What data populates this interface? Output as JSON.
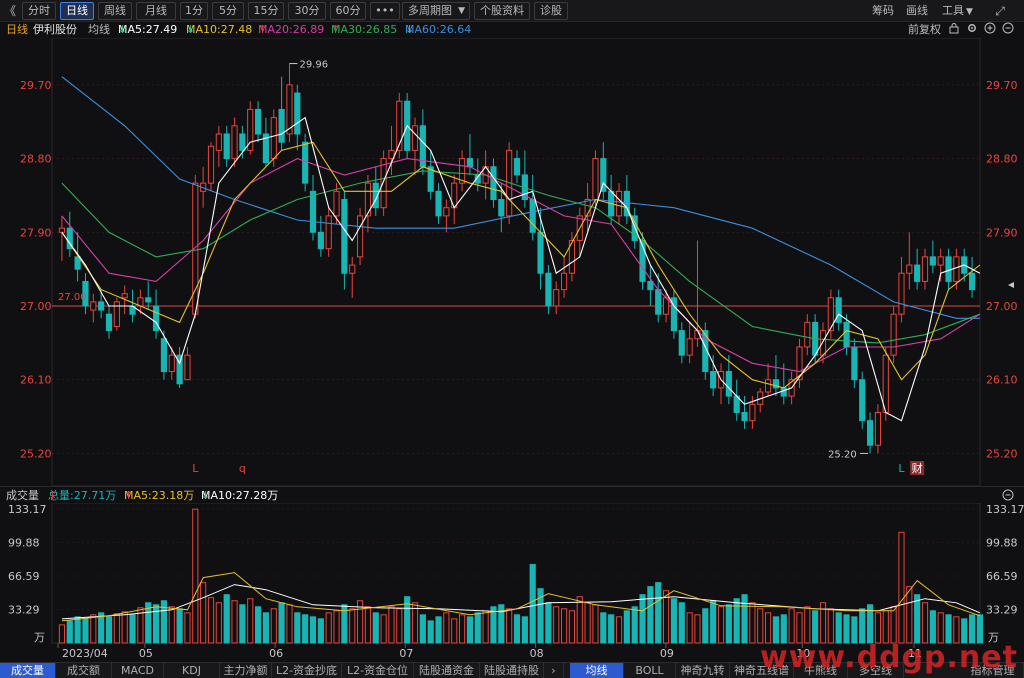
{
  "toolbar": {
    "collapse_icon": "《",
    "period_buttons": [
      "分时",
      "日线",
      "周线",
      "月线",
      "1分",
      "5分",
      "15分",
      "30分",
      "60分"
    ],
    "active_period": "日线",
    "more_button": "•••",
    "multi_period": "多周期图",
    "stock_info": "个股资料",
    "diagnose": "诊股",
    "chip": "筹码",
    "draw": "画线",
    "tools": "工具",
    "expand_icon": "⤢"
  },
  "legend": {
    "period": "日线",
    "stock_name": "伊利股份",
    "indicator": "均线",
    "ma5": "MA5:27.49",
    "ma10": "MA10:27.48",
    "ma20": "MA20:26.89",
    "ma30": "MA30:26.85",
    "ma60": "MA60:26.64",
    "adjust": "前复权"
  },
  "volume_header": {
    "title": "成交量",
    "total": "总量:27.71万",
    "ma5": "MA5:23.18万",
    "ma10": "MA10:27.28万"
  },
  "colors": {
    "up": "#e8453c",
    "down": "#19b5b5",
    "ma5": "#ffffff",
    "ma10": "#e7c12a",
    "ma20": "#d63fa8",
    "ma30": "#2fae57",
    "ma60": "#3b8fe0",
    "axis_label": "#e8453c",
    "grid": "#3a1c1c"
  },
  "chart_data": {
    "type": "candlestick",
    "price_axis_labels": [
      "29.70",
      "28.80",
      "27.90",
      "27.00",
      "26.10",
      "25.20"
    ],
    "ylim": [
      24.9,
      30.15
    ],
    "ref_price_label": "27.00",
    "annotations": {
      "high_label": "29.96",
      "low_label": "25.20",
      "markers": [
        "L",
        "q",
        "L",
        "财"
      ]
    },
    "x_labels": [
      "2023/04",
      "05",
      "06",
      "07",
      "08",
      "09",
      "10",
      "11"
    ],
    "candles": [
      [
        27.9,
        28.1,
        27.55,
        27.95
      ],
      [
        27.95,
        28.15,
        27.6,
        27.7
      ],
      [
        27.6,
        27.9,
        27.3,
        27.45
      ],
      [
        27.3,
        27.4,
        26.9,
        27.0
      ],
      [
        26.95,
        27.15,
        26.8,
        27.05
      ],
      [
        27.05,
        27.2,
        26.85,
        26.95
      ],
      [
        26.9,
        27.0,
        26.6,
        26.7
      ],
      [
        26.75,
        27.1,
        26.7,
        27.05
      ],
      [
        27.1,
        27.25,
        26.9,
        27.15
      ],
      [
        27.0,
        27.2,
        26.8,
        26.9
      ],
      [
        27.0,
        27.2,
        26.9,
        27.1
      ],
      [
        27.1,
        27.3,
        26.95,
        27.05
      ],
      [
        27.0,
        27.2,
        26.6,
        26.7
      ],
      [
        26.6,
        26.7,
        26.1,
        26.2
      ],
      [
        26.2,
        26.5,
        26.1,
        26.4
      ],
      [
        26.4,
        26.5,
        26.0,
        26.05
      ],
      [
        26.1,
        26.5,
        26.1,
        26.4
      ],
      [
        26.9,
        28.6,
        26.85,
        28.5
      ],
      [
        28.4,
        28.7,
        28.2,
        28.5
      ],
      [
        28.5,
        29.0,
        28.4,
        28.95
      ],
      [
        28.9,
        29.2,
        28.7,
        29.1
      ],
      [
        29.1,
        29.2,
        28.7,
        28.8
      ],
      [
        28.8,
        29.3,
        28.7,
        29.2
      ],
      [
        29.1,
        29.2,
        28.8,
        28.9
      ],
      [
        28.9,
        29.5,
        28.85,
        29.4
      ],
      [
        29.4,
        29.5,
        29.0,
        29.1
      ],
      [
        29.1,
        29.3,
        28.7,
        28.75
      ],
      [
        28.8,
        29.4,
        28.7,
        29.3
      ],
      [
        29.4,
        29.8,
        28.9,
        29.0
      ],
      [
        29.1,
        29.96,
        29.0,
        29.7
      ],
      [
        29.6,
        29.7,
        28.9,
        29.1
      ],
      [
        29.0,
        29.1,
        28.4,
        28.5
      ],
      [
        28.4,
        28.6,
        27.8,
        27.9
      ],
      [
        27.9,
        28.1,
        27.6,
        27.7
      ],
      [
        27.7,
        28.2,
        27.6,
        28.1
      ],
      [
        28.1,
        28.5,
        28.0,
        28.4
      ],
      [
        28.3,
        28.4,
        27.2,
        27.4
      ],
      [
        27.4,
        27.6,
        27.1,
        27.5
      ],
      [
        27.6,
        28.2,
        27.5,
        28.1
      ],
      [
        28.1,
        28.6,
        27.9,
        28.5
      ],
      [
        28.5,
        28.7,
        28.1,
        28.2
      ],
      [
        28.2,
        28.9,
        28.1,
        28.8
      ],
      [
        28.8,
        29.2,
        28.6,
        28.9
      ],
      [
        28.9,
        29.6,
        28.8,
        29.5
      ],
      [
        29.5,
        29.6,
        28.8,
        28.9
      ],
      [
        28.9,
        29.3,
        28.6,
        29.2
      ],
      [
        29.2,
        29.4,
        28.6,
        28.7
      ],
      [
        28.7,
        28.9,
        28.3,
        28.4
      ],
      [
        28.4,
        28.5,
        28.0,
        28.1
      ],
      [
        28.1,
        28.3,
        27.9,
        28.2
      ],
      [
        28.2,
        28.6,
        28.0,
        28.5
      ],
      [
        28.5,
        28.9,
        28.4,
        28.8
      ],
      [
        28.8,
        29.1,
        28.6,
        28.7
      ],
      [
        28.6,
        28.8,
        28.4,
        28.5
      ],
      [
        28.5,
        28.9,
        28.3,
        28.7
      ],
      [
        28.7,
        28.8,
        28.2,
        28.3
      ],
      [
        28.3,
        28.5,
        27.9,
        28.1
      ],
      [
        28.1,
        29.0,
        28.0,
        28.9
      ],
      [
        28.8,
        28.9,
        28.5,
        28.6
      ],
      [
        28.6,
        28.9,
        28.2,
        28.3
      ],
      [
        28.3,
        28.6,
        27.8,
        27.9
      ],
      [
        27.9,
        28.2,
        27.2,
        27.4
      ],
      [
        27.4,
        27.5,
        26.9,
        27.0
      ],
      [
        27.0,
        27.3,
        26.9,
        27.2
      ],
      [
        27.2,
        27.6,
        27.1,
        27.4
      ],
      [
        27.4,
        27.9,
        27.3,
        27.8
      ],
      [
        27.8,
        28.2,
        27.6,
        28.1
      ],
      [
        28.1,
        28.5,
        27.9,
        28.3
      ],
      [
        28.3,
        28.9,
        28.2,
        28.8
      ],
      [
        28.8,
        29.0,
        28.3,
        28.4
      ],
      [
        28.4,
        28.6,
        28.0,
        28.1
      ],
      [
        28.1,
        28.5,
        28.0,
        28.4
      ],
      [
        28.4,
        28.6,
        28.0,
        28.1
      ],
      [
        28.1,
        28.2,
        27.7,
        27.8
      ],
      [
        27.8,
        27.9,
        27.2,
        27.3
      ],
      [
        27.3,
        27.5,
        27.0,
        27.2
      ],
      [
        27.2,
        27.4,
        26.8,
        26.9
      ],
      [
        26.9,
        27.2,
        26.8,
        27.1
      ],
      [
        27.1,
        27.2,
        26.6,
        26.7
      ],
      [
        26.7,
        26.8,
        26.3,
        26.4
      ],
      [
        26.4,
        26.8,
        26.3,
        26.6
      ],
      [
        26.6,
        27.8,
        26.5,
        26.7
      ],
      [
        26.7,
        26.8,
        26.1,
        26.2
      ],
      [
        26.2,
        26.4,
        25.9,
        26.0
      ],
      [
        26.0,
        26.3,
        25.8,
        26.2
      ],
      [
        26.2,
        26.4,
        25.8,
        25.9
      ],
      [
        25.9,
        26.1,
        25.6,
        25.7
      ],
      [
        25.7,
        25.9,
        25.5,
        25.6
      ],
      [
        25.6,
        25.9,
        25.5,
        25.8
      ],
      [
        25.8,
        26.0,
        25.7,
        25.95
      ],
      [
        25.95,
        26.3,
        25.9,
        26.1
      ],
      [
        26.1,
        26.4,
        25.9,
        26.0
      ],
      [
        26.0,
        26.3,
        25.8,
        25.9
      ],
      [
        25.9,
        26.2,
        25.8,
        26.1
      ],
      [
        26.1,
        26.6,
        26.0,
        26.5
      ],
      [
        26.5,
        26.9,
        26.4,
        26.8
      ],
      [
        26.8,
        26.9,
        26.3,
        26.4
      ],
      [
        26.4,
        26.8,
        26.3,
        26.7
      ],
      [
        26.7,
        27.2,
        26.6,
        27.1
      ],
      [
        27.1,
        27.2,
        26.7,
        26.8
      ],
      [
        26.8,
        26.9,
        26.4,
        26.5
      ],
      [
        26.5,
        26.6,
        26.0,
        26.1
      ],
      [
        26.1,
        26.2,
        25.5,
        25.6
      ],
      [
        25.6,
        25.7,
        25.2,
        25.3
      ],
      [
        25.3,
        25.8,
        25.2,
        25.7
      ],
      [
        25.7,
        26.5,
        25.6,
        26.4
      ],
      [
        26.4,
        27.0,
        26.3,
        26.9
      ],
      [
        26.9,
        27.6,
        26.8,
        27.4
      ],
      [
        27.4,
        27.9,
        27.2,
        27.5
      ],
      [
        27.5,
        27.7,
        27.2,
        27.3
      ],
      [
        27.3,
        27.7,
        27.2,
        27.6
      ],
      [
        27.6,
        27.8,
        27.4,
        27.5
      ],
      [
        27.5,
        27.7,
        27.3,
        27.6
      ],
      [
        27.6,
        27.7,
        27.2,
        27.3
      ],
      [
        27.3,
        27.7,
        27.2,
        27.6
      ],
      [
        27.6,
        27.7,
        27.3,
        27.4
      ],
      [
        27.4,
        27.6,
        27.1,
        27.2
      ]
    ],
    "ma_lines": {
      "ma60": [
        [
          0,
          29.8
        ],
        [
          8,
          29.2
        ],
        [
          15,
          28.55
        ],
        [
          22,
          28.3
        ],
        [
          30,
          28.05
        ],
        [
          40,
          27.95
        ],
        [
          50,
          27.95
        ],
        [
          60,
          28.15
        ],
        [
          68,
          28.3
        ],
        [
          78,
          28.2
        ],
        [
          88,
          27.95
        ],
        [
          98,
          27.5
        ],
        [
          106,
          27.05
        ],
        [
          114,
          26.85
        ],
        [
          117,
          26.85
        ]
      ],
      "ma30": [
        [
          0,
          28.5
        ],
        [
          6,
          27.9
        ],
        [
          12,
          27.6
        ],
        [
          18,
          27.7
        ],
        [
          24,
          28.05
        ],
        [
          30,
          28.3
        ],
        [
          38,
          28.5
        ],
        [
          46,
          28.65
        ],
        [
          54,
          28.6
        ],
        [
          62,
          28.35
        ],
        [
          68,
          28.2
        ],
        [
          74,
          27.8
        ],
        [
          80,
          27.3
        ],
        [
          88,
          26.75
        ],
        [
          96,
          26.6
        ],
        [
          104,
          26.55
        ],
        [
          110,
          26.65
        ],
        [
          117,
          26.9
        ]
      ],
      "ma20": [
        [
          0,
          28.1
        ],
        [
          6,
          27.4
        ],
        [
          12,
          27.3
        ],
        [
          18,
          27.8
        ],
        [
          24,
          28.5
        ],
        [
          30,
          28.8
        ],
        [
          36,
          28.6
        ],
        [
          44,
          28.8
        ],
        [
          52,
          28.7
        ],
        [
          58,
          28.4
        ],
        [
          64,
          28.1
        ],
        [
          70,
          28.0
        ],
        [
          76,
          27.2
        ],
        [
          82,
          26.6
        ],
        [
          88,
          26.3
        ],
        [
          94,
          26.2
        ],
        [
          100,
          26.5
        ],
        [
          106,
          26.5
        ],
        [
          112,
          26.6
        ],
        [
          117,
          26.9
        ]
      ],
      "ma10": [
        [
          0,
          27.9
        ],
        [
          5,
          27.2
        ],
        [
          10,
          27.0
        ],
        [
          15,
          26.8
        ],
        [
          18,
          27.4
        ],
        [
          22,
          28.3
        ],
        [
          28,
          28.9
        ],
        [
          32,
          29.0
        ],
        [
          36,
          28.4
        ],
        [
          42,
          28.4
        ],
        [
          46,
          28.7
        ],
        [
          52,
          28.5
        ],
        [
          56,
          28.4
        ],
        [
          60,
          28.0
        ],
        [
          64,
          27.6
        ],
        [
          68,
          28.3
        ],
        [
          72,
          28.2
        ],
        [
          76,
          27.5
        ],
        [
          80,
          26.9
        ],
        [
          84,
          26.4
        ],
        [
          88,
          26.1
        ],
        [
          92,
          26.0
        ],
        [
          96,
          26.3
        ],
        [
          100,
          26.7
        ],
        [
          104,
          26.6
        ],
        [
          107,
          26.1
        ],
        [
          110,
          26.4
        ],
        [
          113,
          27.2
        ],
        [
          117,
          27.5
        ]
      ],
      "ma5": [
        [
          0,
          27.9
        ],
        [
          3,
          27.5
        ],
        [
          6,
          27.0
        ],
        [
          9,
          27.0
        ],
        [
          12,
          26.8
        ],
        [
          15,
          26.3
        ],
        [
          17,
          26.9
        ],
        [
          20,
          28.5
        ],
        [
          24,
          29.0
        ],
        [
          28,
          29.1
        ],
        [
          31,
          29.3
        ],
        [
          34,
          28.2
        ],
        [
          37,
          27.8
        ],
        [
          40,
          28.3
        ],
        [
          44,
          29.2
        ],
        [
          47,
          28.9
        ],
        [
          50,
          28.2
        ],
        [
          54,
          28.7
        ],
        [
          57,
          28.3
        ],
        [
          60,
          28.4
        ],
        [
          63,
          27.4
        ],
        [
          66,
          27.6
        ],
        [
          69,
          28.5
        ],
        [
          72,
          28.2
        ],
        [
          75,
          27.5
        ],
        [
          78,
          27.0
        ],
        [
          81,
          26.7
        ],
        [
          84,
          26.1
        ],
        [
          87,
          25.8
        ],
        [
          90,
          25.9
        ],
        [
          93,
          26.0
        ],
        [
          96,
          26.4
        ],
        [
          99,
          26.9
        ],
        [
          102,
          26.7
        ],
        [
          105,
          25.7
        ],
        [
          107,
          25.6
        ],
        [
          110,
          26.5
        ],
        [
          112,
          27.4
        ],
        [
          115,
          27.5
        ],
        [
          117,
          27.4
        ]
      ]
    },
    "volume_axis_labels": [
      "133.17",
      "99.88",
      "66.59",
      "33.29"
    ],
    "volume_unit": "万",
    "volume_ylim": [
      0,
      133.17
    ],
    "volumes": [
      18,
      22,
      26,
      24,
      28,
      30,
      26,
      29,
      31,
      28,
      35,
      40,
      38,
      42,
      36,
      34,
      30,
      133,
      60,
      45,
      40,
      48,
      42,
      38,
      44,
      36,
      30,
      34,
      40,
      38,
      30,
      28,
      26,
      24,
      30,
      32,
      38,
      34,
      42,
      36,
      30,
      28,
      36,
      34,
      46,
      40,
      28,
      22,
      26,
      30,
      24,
      28,
      26,
      30,
      32,
      36,
      38,
      34,
      28,
      26,
      78,
      54,
      40,
      36,
      34,
      32,
      46,
      40,
      38,
      30,
      28,
      26,
      32,
      36,
      48,
      56,
      60,
      52,
      44,
      40,
      30,
      28,
      34,
      42,
      36,
      38,
      44,
      48,
      40,
      34,
      30,
      26,
      28,
      34,
      30,
      36,
      32,
      40,
      34,
      30,
      28,
      26,
      34,
      38,
      30,
      32,
      36,
      110,
      56,
      48,
      40,
      32,
      30,
      28,
      26,
      24,
      28,
      28
    ],
    "vol_ma5": [
      [
        0,
        22
      ],
      [
        6,
        27
      ],
      [
        12,
        36
      ],
      [
        16,
        33
      ],
      [
        18,
        65
      ],
      [
        22,
        70
      ],
      [
        26,
        44
      ],
      [
        30,
        36
      ],
      [
        36,
        32
      ],
      [
        44,
        39
      ],
      [
        52,
        28
      ],
      [
        58,
        34
      ],
      [
        62,
        49
      ],
      [
        68,
        38
      ],
      [
        74,
        32
      ],
      [
        78,
        52
      ],
      [
        84,
        37
      ],
      [
        92,
        36
      ],
      [
        100,
        32
      ],
      [
        106,
        32
      ],
      [
        109,
        62
      ],
      [
        113,
        38
      ],
      [
        117,
        27
      ]
    ],
    "vol_ma10": [
      [
        0,
        24
      ],
      [
        8,
        28
      ],
      [
        14,
        33
      ],
      [
        18,
        45
      ],
      [
        22,
        58
      ],
      [
        26,
        53
      ],
      [
        32,
        38
      ],
      [
        40,
        35
      ],
      [
        48,
        34
      ],
      [
        56,
        31
      ],
      [
        62,
        40
      ],
      [
        70,
        41
      ],
      [
        78,
        46
      ],
      [
        86,
        40
      ],
      [
        96,
        34
      ],
      [
        104,
        32
      ],
      [
        110,
        44
      ],
      [
        114,
        40
      ],
      [
        117,
        30
      ]
    ]
  },
  "tabs": [
    "成交量",
    "成交额",
    "MACD",
    "KDJ",
    "主力净额",
    "L2-资金抄底",
    "L2-资金仓位",
    "陆股通资金",
    "陆股通持股",
    "均线",
    "BOLL",
    "神奇九转",
    "神奇五线谱",
    "牛熊线",
    "多空线",
    "指标管理"
  ],
  "tab_more_icon": "›",
  "watermark": "www.ddgp.net"
}
